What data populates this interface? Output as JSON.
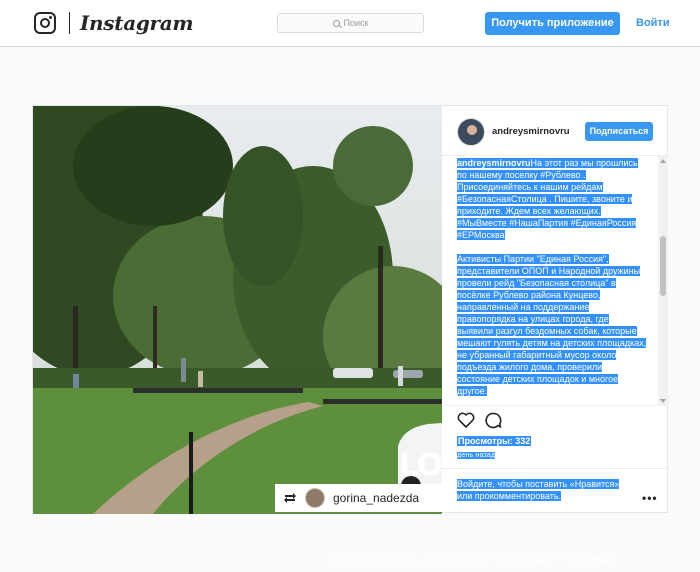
{
  "nav": {
    "brand": "Instagram",
    "search_placeholder": "Поиск",
    "get_app_label": "Получить приложение",
    "login_label": "Войти"
  },
  "post": {
    "author": "andreysmirnovru",
    "follow_label": "Подписаться",
    "repost_user": "gorina_nadezda",
    "caption_user": "andreysmirnovru",
    "caption_p1": "На этот раз мы прошлись по нашему поселку #Рублево . Присоединяйтесь к нашим рейдам #БезопаснаяСтолица . Пишите, звоните и приходите. Ждем всех желающих. #МыВместе #НашаПартия #ЕдинаяРоссия #ЕРМосква",
    "caption_p2": "Активисты Партии \"Единая Россия\", представители ОПОП и Народной дружины провели рейд \"Безопасная столица\" в посёлке Рублево района Кунцево, направленный на поддержание правопорядка на улицах города, где выявили разгул бездомных собак, которые мешают гулять детям на детских площадках, не убранный габаритный мусор около подъезда жилого дома, проверили состояние детских площадок и многое другое.",
    "views": "Просмотры: 332",
    "time_ago": "день назад",
    "login_prompt": "Войдите, чтобы поставить «Нравится» или прокомментировать.",
    "video_overlay_text": "LO"
  },
  "watermark": "Сообщество жителей поселка Рублево",
  "icons": {
    "logo": "instagram-camera-icon",
    "search": "search-icon",
    "like": "heart-icon",
    "comment": "comment-icon",
    "repost": "repost-icon",
    "more": "more-options-icon"
  },
  "colors": {
    "accent": "#3897f0",
    "selection": "#3390ff",
    "background": "#fafafa"
  }
}
